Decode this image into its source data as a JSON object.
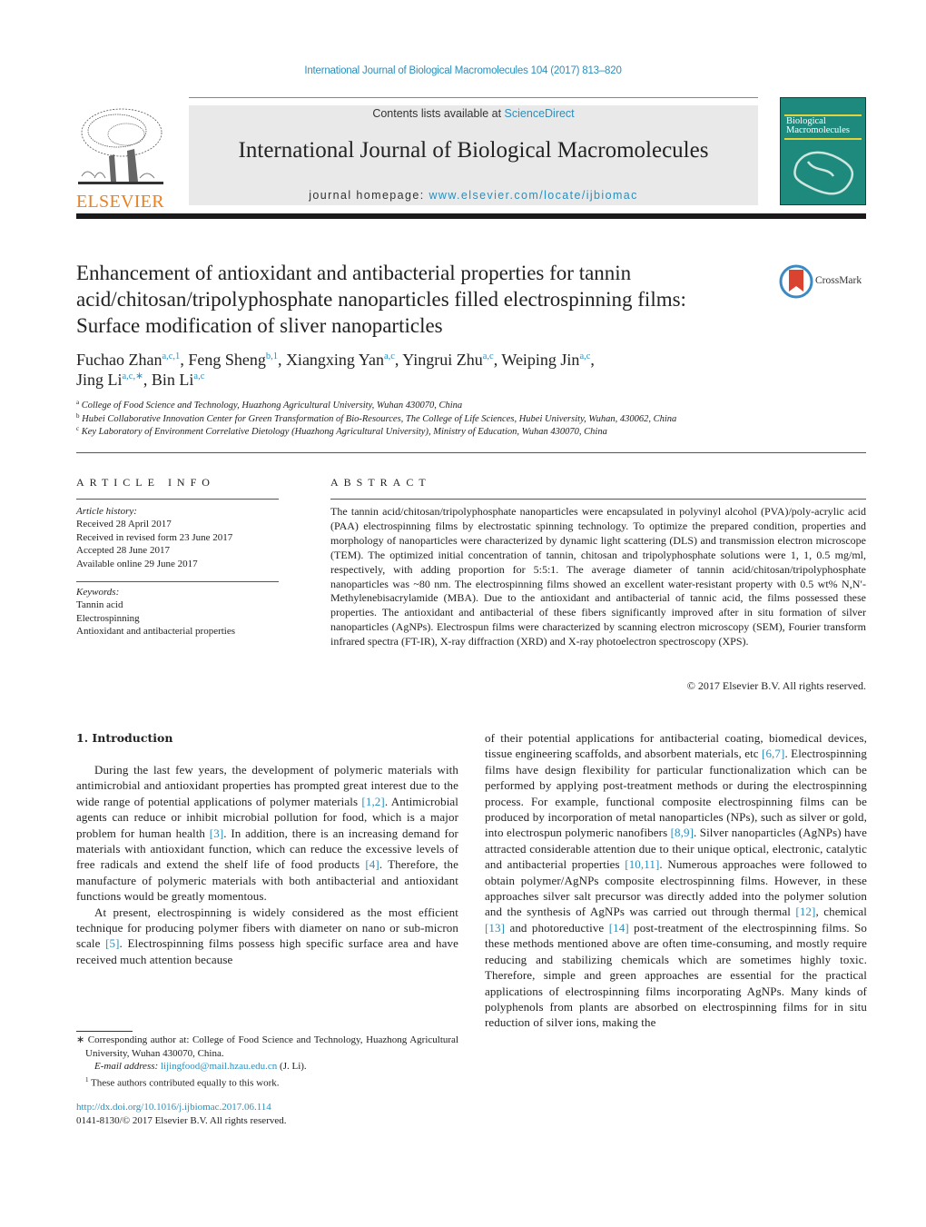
{
  "header": {
    "citation": "International Journal of Biological Macromolecules 104 (2017) 813–820",
    "contents_prefix": "Contents lists available at ",
    "contents_link": "ScienceDirect",
    "journal_title": "International Journal of Biological Macromolecules",
    "homepage_prefix": "journal homepage: ",
    "homepage_link": "www.elsevier.com/locate/ijbiomac",
    "publisher_logo": "ELSEVIER",
    "cover_title": "Biological Macromolecules",
    "colors": {
      "link": "#2a8fbd",
      "elsevier_orange": "#f07f1a",
      "banner_bg": "#e9e9e9",
      "cover_green": "#1e8a7d"
    }
  },
  "article": {
    "title": "Enhancement of antioxidant and antibacterial properties for tannin acid/chitosan/tripolyphosphate nanoparticles filled electrospinning films: Surface modification of sliver nanoparticles",
    "crossmark_label": "CrossMark",
    "authors": [
      {
        "name": "Fuchao Zhan",
        "sup": "a,c,1"
      },
      {
        "name": "Feng Sheng",
        "sup": "b,1"
      },
      {
        "name": "Xiangxing Yan",
        "sup": "a,c"
      },
      {
        "name": "Yingrui Zhu",
        "sup": "a,c"
      },
      {
        "name": "Weiping Jin",
        "sup": "a,c"
      },
      {
        "name": "Jing Li",
        "sup": "a,c,∗"
      },
      {
        "name": "Bin Li",
        "sup": "a,c"
      }
    ],
    "affiliations": [
      {
        "mark": "a",
        "text": "College of Food Science and Technology, Huazhong Agricultural University, Wuhan 430070, China"
      },
      {
        "mark": "b",
        "text": "Hubei Collaborative Innovation Center for Green Transformation of Bio-Resources, The College of Life Sciences, Hubei University, Wuhan, 430062, China"
      },
      {
        "mark": "c",
        "text": "Key Laboratory of Environment Correlative Dietology (Huazhong Agricultural University), Ministry of Education, Wuhan 430070, China"
      }
    ]
  },
  "article_info": {
    "heading": "ARTICLE INFO",
    "history_label": "Article history:",
    "history": [
      "Received 28 April 2017",
      "Received in revised form 23 June 2017",
      "Accepted 28 June 2017",
      "Available online 29 June 2017"
    ],
    "keywords_label": "Keywords:",
    "keywords": [
      "Tannin acid",
      "Electrospinning",
      "Antioxidant and antibacterial properties"
    ]
  },
  "abstract": {
    "heading": "ABSTRACT",
    "text": "The tannin acid/chitosan/tripolyphosphate nanoparticles were encapsulated in polyvinyl alcohol (PVA)/poly-acrylic acid (PAA) electrospinning films by electrostatic spinning technology. To optimize the prepared condition, properties and morphology of nanoparticles were characterized by dynamic light scattering (DLS) and transmission electron microscope (TEM). The optimized initial concentration of tannin, chitosan and tripolyphosphate solutions were 1, 1, 0.5 mg/ml, respectively, with adding proportion for 5:5:1. The average diameter of tannin acid/chitosan/tripolyphosphate nanoparticles was ~80 nm. The electrospinning films showed an excellent water-resistant property with 0.5 wt% N,N′-Methylenebisacrylamide (MBA). Due to the antioxidant and antibacterial of tannic acid, the films possessed these properties. The antioxidant and antibacterial of these fibers significantly improved after in situ formation of silver nanoparticles (AgNPs). Electrospun films were characterized by scanning electron microscopy (SEM), Fourier transform infrared spectra (FT-IR), X-ray diffraction (XRD) and X-ray photoelectron spectroscopy (XPS).",
    "copyright": "© 2017 Elsevier B.V. All rights reserved."
  },
  "introduction": {
    "heading": "1.  Introduction",
    "col1": [
      [
        {
          "t": "During the last few years, the development of polymeric materials with antimicrobial and antioxidant properties has prompted great interest due to the wide range of potential applications of polymer materials "
        },
        {
          "r": "[1,2]"
        },
        {
          "t": ". Antimicrobial agents can reduce or inhibit microbial pollution for food, which is a major problem for human health "
        },
        {
          "r": "[3]"
        },
        {
          "t": ". In addition, there is an increasing demand for materials with antioxidant function, which can reduce the excessive levels of free radicals and extend the shelf life of food products "
        },
        {
          "r": "[4]"
        },
        {
          "t": ". Therefore, the manufacture of polymeric materials with both antibacterial and antioxidant functions would be greatly momentous."
        }
      ],
      [
        {
          "t": "At present, electrospinning is widely considered as the most efficient technique for producing polymer fibers with diameter on nano or sub-micron scale "
        },
        {
          "r": "[5]"
        },
        {
          "t": ". Electrospinning films possess high specific surface area and have received much attention because"
        }
      ]
    ],
    "col2": [
      [
        {
          "t": "of their potential applications for antibacterial coating, biomedical devices, tissue engineering scaffolds, and absorbent materials, etc "
        },
        {
          "r": "[6,7]"
        },
        {
          "t": ". Electrospinning films have design flexibility for particular functionalization which can be performed by applying post-treatment methods or during the electrospinning process. For example, functional composite electrospinning films can be produced by incorporation of metal nanoparticles (NPs), such as silver or gold, into electrospun polymeric nanofibers "
        },
        {
          "r": "[8,9]"
        },
        {
          "t": ". Silver nanoparticles (AgNPs) have attracted considerable attention due to their unique optical, electronic, catalytic and antibacterial properties "
        },
        {
          "r": "[10,11]"
        },
        {
          "t": ". Numerous approaches were followed to obtain polymer/AgNPs composite electrospinning films. However, in these approaches silver salt precursor was directly added into the polymer solution and the synthesis of AgNPs was carried out through thermal "
        },
        {
          "r": "[12]"
        },
        {
          "t": ", chemical "
        },
        {
          "r": "[13]"
        },
        {
          "t": " and photoreductive "
        },
        {
          "r": "[14]"
        },
        {
          "t": " post-treatment of the electrospinning films. So these methods mentioned above are often time-consuming, and mostly require reducing and stabilizing chemicals which are sometimes highly toxic. Therefore, simple and green approaches are essential for the practical applications of electrospinning films incorporating AgNPs. Many kinds of polyphenols from plants are absorbed on electrospinning films for in situ reduction of silver ions, making the"
        }
      ]
    ]
  },
  "footnotes": {
    "corresponding": "∗  Corresponding author at: College of Food Science and Technology, Huazhong Agricultural University, Wuhan 430070, China.",
    "email_label": "E-mail address: ",
    "email": "lijingfood@mail.hzau.edu.cn",
    "email_suffix": " (J. Li).",
    "equal_mark": "1",
    "equal": " These authors contributed equally to this work.",
    "doi": "http://dx.doi.org/10.1016/j.ijbiomac.2017.06.114",
    "issn": "0141-8130/© 2017 Elsevier B.V. All rights reserved."
  }
}
